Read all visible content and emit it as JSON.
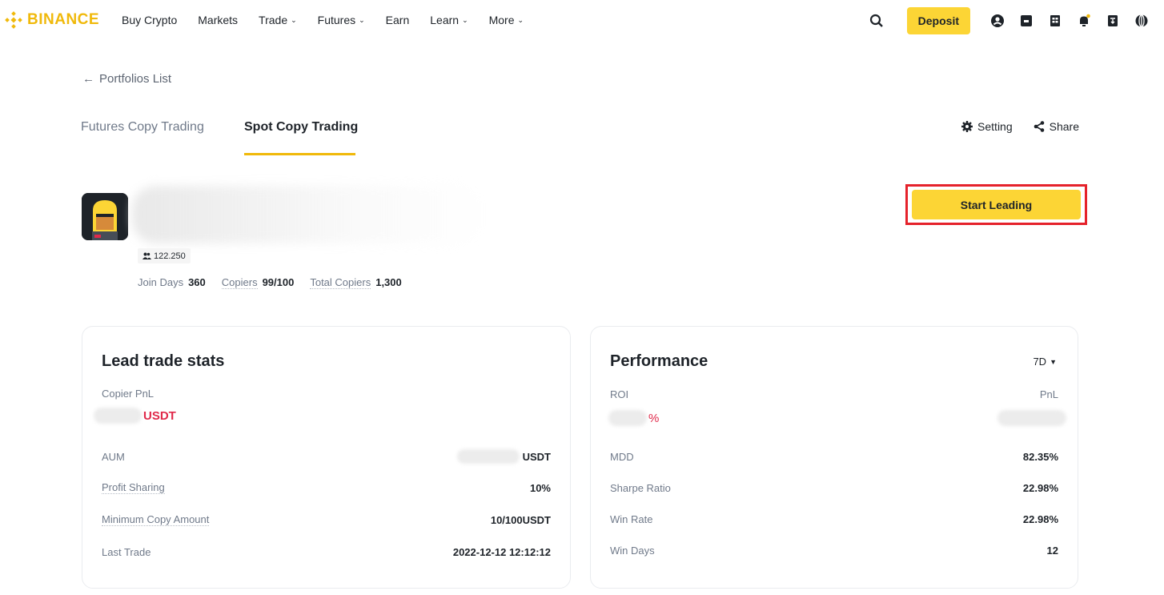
{
  "nav": {
    "logo_text": "BINANCE",
    "items": [
      {
        "label": "Buy Crypto",
        "dropdown": false
      },
      {
        "label": "Markets",
        "dropdown": false
      },
      {
        "label": "Trade",
        "dropdown": true
      },
      {
        "label": "Futures",
        "dropdown": true
      },
      {
        "label": "Earn",
        "dropdown": false
      },
      {
        "label": "Learn",
        "dropdown": true
      },
      {
        "label": "More",
        "dropdown": true
      }
    ],
    "deposit_label": "Deposit",
    "icons": [
      "search-icon",
      "user-icon",
      "wallet-icon",
      "orders-icon",
      "notification-icon",
      "download-icon",
      "globe-icon"
    ]
  },
  "back": {
    "label": "Portfolios List"
  },
  "tabs": [
    {
      "label": "Futures Copy Trading",
      "active": false
    },
    {
      "label": "Spot Copy Trading",
      "active": true
    }
  ],
  "actions": {
    "setting_label": "Setting",
    "share_label": "Share"
  },
  "profile": {
    "followers": "122.250",
    "stats": [
      {
        "label": "Join Days",
        "value": "360"
      },
      {
        "label": "Copiers",
        "value": "99/100"
      },
      {
        "label": "Total Copiers",
        "value": "1,300"
      }
    ],
    "start_leading_label": "Start Leading"
  },
  "lead_stats": {
    "title": "Lead trade stats",
    "copier_pnl_label": "Copier PnL",
    "copier_pnl_unit": "USDT",
    "rows": [
      {
        "label": "AUM",
        "value": "USDT",
        "blurred_value": true
      },
      {
        "label": "Profit Sharing",
        "value": "10%"
      },
      {
        "label": "Minimum Copy Amount",
        "value": "10/100USDT"
      },
      {
        "label": "Last Trade",
        "value": "2022-12-12 12:12:12"
      }
    ]
  },
  "performance": {
    "title": "Performance",
    "period": "7D",
    "roi_label": "ROI",
    "roi_unit": "%",
    "pnl_label": "PnL",
    "rows": [
      {
        "label": "MDD",
        "value": "82.35%"
      },
      {
        "label": "Sharpe Ratio",
        "value": "22.98%"
      },
      {
        "label": "Win Rate",
        "value": "22.98%"
      },
      {
        "label": "Win Days",
        "value": "12"
      }
    ]
  },
  "colors": {
    "brand": "#f0b90b",
    "button": "#fcd535",
    "negative": "#e0294a",
    "highlight_outline": "#e5222b"
  }
}
